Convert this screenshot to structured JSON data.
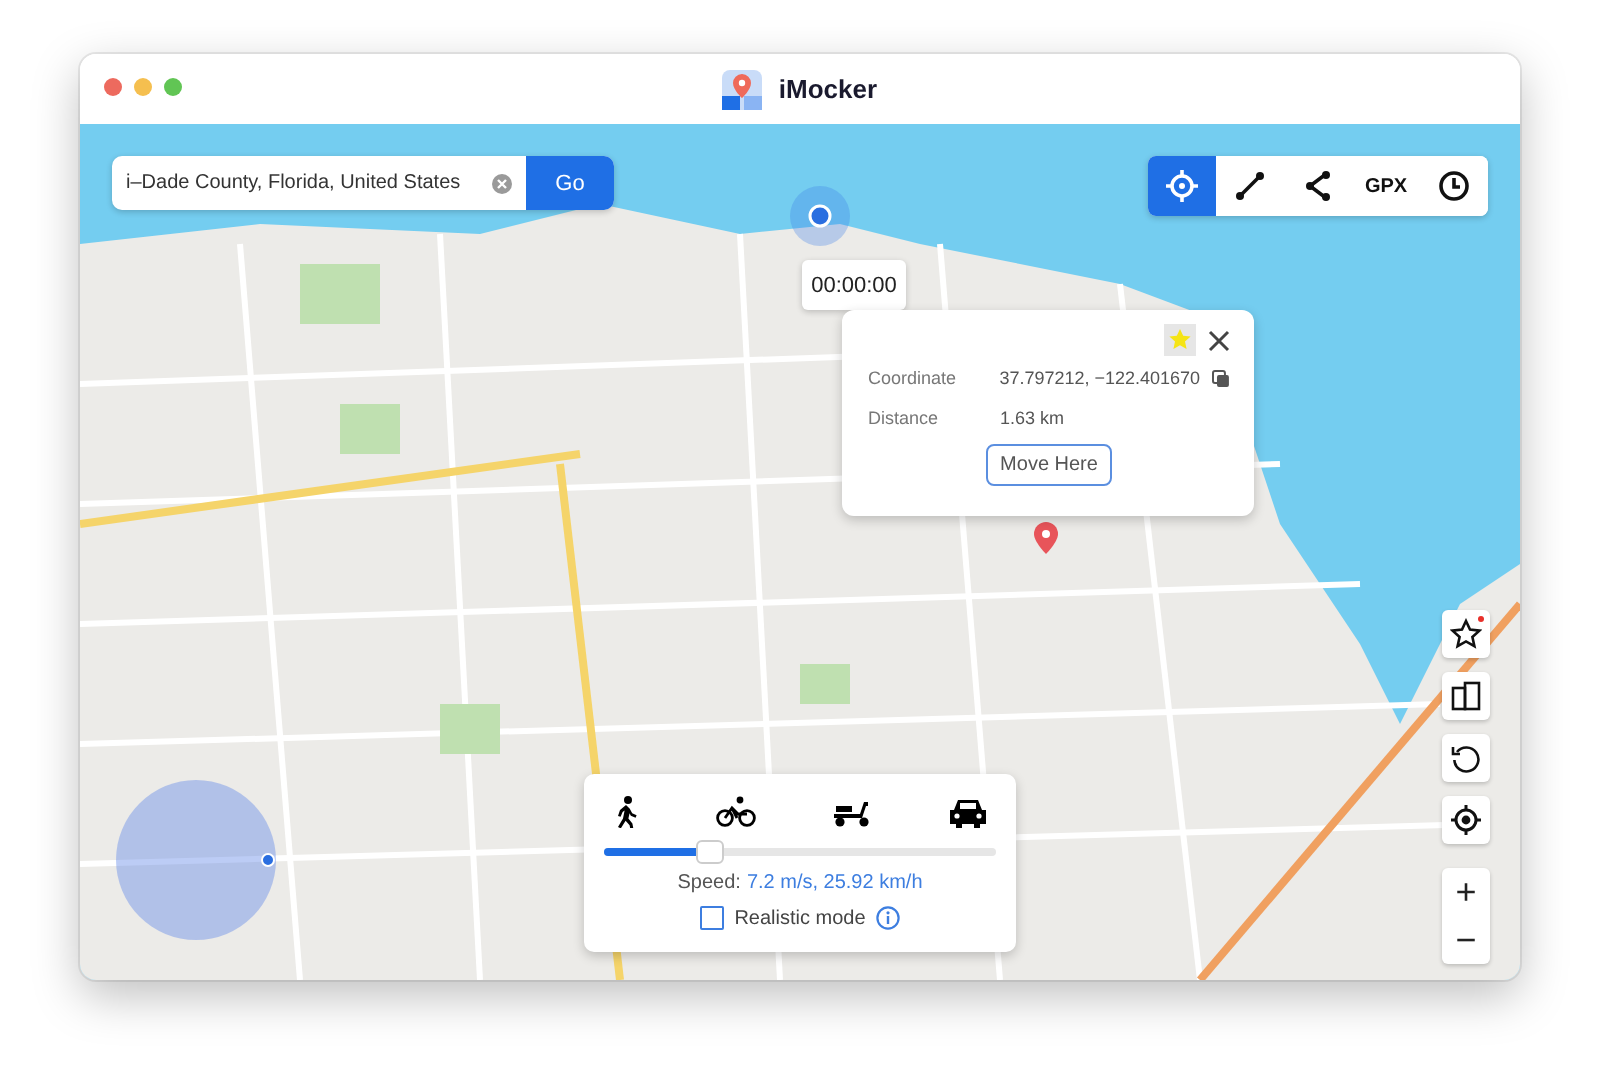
{
  "window": {
    "title": "iMocker"
  },
  "search": {
    "value": "i–Dade County, Florida, United States",
    "button": "Go"
  },
  "mode_tools": [
    {
      "kind": "crosshair",
      "selected": true
    },
    {
      "kind": "route",
      "selected": false
    },
    {
      "kind": "multi",
      "selected": false
    },
    {
      "kind": "text",
      "label": "GPX",
      "selected": false
    },
    {
      "kind": "clock",
      "selected": false
    }
  ],
  "timer": "00:00:00",
  "popup": {
    "favorite": true,
    "coordinate_label": "Coordinate",
    "coordinate": "37.797212, −122.401670",
    "distance_label": "Distance",
    "distance": "1.63 km",
    "button": "Move Here"
  },
  "speed_panel": {
    "level": 0.27,
    "speed_label": "Speed:",
    "speed": "7.2 m/s, 25.92 km/h",
    "realistic_mode": {
      "label": "Realistic mode",
      "checked": false
    }
  },
  "side_controls": [
    {
      "kind": "star",
      "notification": true
    },
    {
      "kind": "screens",
      "notification": false
    },
    {
      "kind": "reset",
      "notification": false
    },
    {
      "kind": "locate",
      "notification": false
    }
  ],
  "zoom": {
    "plus": "+",
    "minus": "−"
  }
}
